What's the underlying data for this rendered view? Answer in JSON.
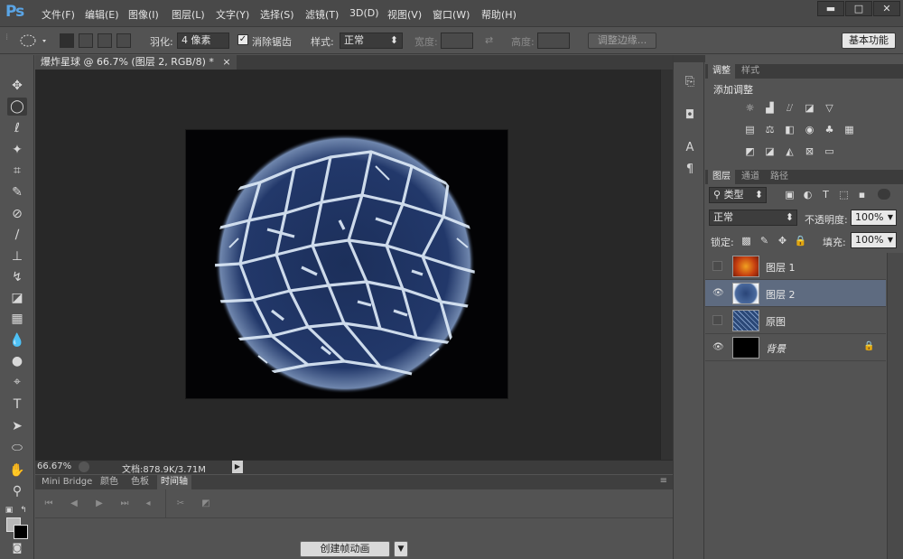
{
  "app": {
    "logo": "Ps"
  },
  "menu": [
    "文件(F)",
    "编辑(E)",
    "图像(I)",
    "图层(L)",
    "文字(Y)",
    "选择(S)",
    "滤镜(T)",
    "3D(D)",
    "视图(V)",
    "窗口(W)",
    "帮助(H)"
  ],
  "window_controls": {
    "minimize": "▬",
    "maximize": "□",
    "close": "✕"
  },
  "options": {
    "feather_label": "羽化:",
    "feather_value": "4 像素",
    "antialias_label": "消除锯齿",
    "antialias_checked": true,
    "style_label": "样式:",
    "style_value": "正常",
    "width_label": "宽度:",
    "height_label": "高度:",
    "refine_edge": "调整边缘...",
    "workspace": "基本功能"
  },
  "document": {
    "tab_title": "爆炸星球 @ 66.7% (图层 2, RGB/8) *",
    "tab_close": "×",
    "zoom": "66.67%",
    "doc_info": "文档:878.9K/3.71M"
  },
  "bottom_panel": {
    "tabs": [
      "Mini Bridge",
      "颜色",
      "色板",
      "时间轴"
    ],
    "active_tab": "时间轴",
    "create_button": "创建帧动画"
  },
  "adjustments": {
    "tabs": [
      "调整",
      "样式"
    ],
    "active_tab": "调整",
    "title": "添加调整"
  },
  "layers_panel": {
    "tabs": [
      "图层",
      "通道",
      "路径"
    ],
    "active_tab": "图层",
    "filter_kind": "类型",
    "blend_mode": "正常",
    "opacity_label": "不透明度:",
    "opacity_value": "100%",
    "lock_label": "锁定:",
    "fill_label": "填充:",
    "fill_value": "100%",
    "layers": [
      {
        "name": "图层 1",
        "visible": false,
        "selected": false,
        "thumb": "orange-texture"
      },
      {
        "name": "图层 2",
        "visible": true,
        "selected": true,
        "thumb": "blue-sphere"
      },
      {
        "name": "原图",
        "visible": false,
        "selected": false,
        "thumb": "blue-texture"
      },
      {
        "name": "背景",
        "visible": true,
        "selected": false,
        "thumb": "black",
        "locked": true
      }
    ]
  },
  "colors": {
    "selection": "#5e6b80",
    "canvas_bg": "#282828",
    "accent": "#5aa5e6"
  }
}
